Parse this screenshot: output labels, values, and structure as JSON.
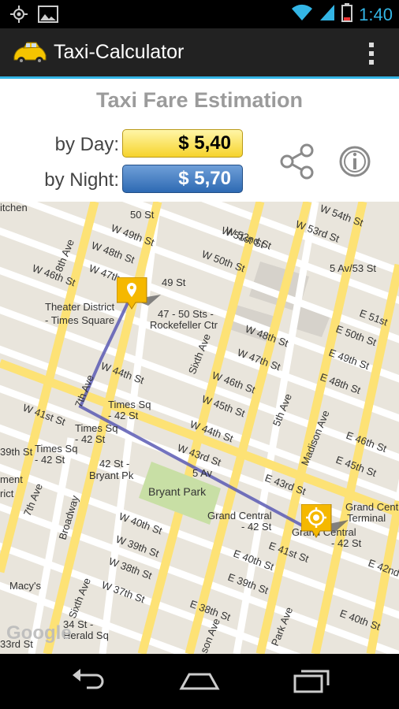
{
  "status": {
    "time": "1:40"
  },
  "app": {
    "title": "Taxi-Calculator"
  },
  "fare": {
    "heading": "Taxi Fare Estimation",
    "day_label": "by Day:",
    "day_value": "$ 5,40",
    "night_label": "by Night:",
    "night_value": "$ 5,70"
  },
  "map": {
    "labels": {
      "kitchen": "itchen",
      "w52": "W 52nd St",
      "w54": "W 54th St",
      "st50": "50 St",
      "w49": "W 49th St",
      "w51": "W 51st St",
      "w53": "W 53rd St",
      "ave8": "8th Ave",
      "w48a": "W 48th St",
      "w50": "W 50th St",
      "av5_53": "5 Av/53 St",
      "w46": "W 46th St",
      "w47a": "W 47th St",
      "st49": "49 St",
      "theater1": "Theater District",
      "theater2": "- Times Square",
      "rock1": "47 - 50 Sts -",
      "rock2": "Rockefeller Ctr",
      "e51": "E 51st",
      "w48b": "W 48th St",
      "e50": "E 50th St",
      "sixth_ave_n": "Sixth Ave",
      "w47b": "W 47th St",
      "e49": "E 49th St",
      "w44a": "W 44th St",
      "w46b": "W 46th St",
      "e48": "E 48th St",
      "ave7": "7th Ave",
      "w45": "W 45th St",
      "fifth_ave": "5th Ave",
      "ts1": "Times Sq",
      "ts2": "- 42 St",
      "w41": "W 41st St",
      "ts3": "Times Sq",
      "ts4": "- 42 St",
      "w44b": "W 44th St",
      "madison": "Madison Ave",
      "e46": "E 46th St",
      "w43": "W 43rd St",
      "ts5": "Times Sq",
      "ts6": "- 42 St",
      "e45": "E 45th St",
      "w39": "39th St",
      "bp1": "42 St -",
      "bp2": "Bryant Pk",
      "av5": "5 Av",
      "e43": "E 43rd St",
      "ment": "ment",
      "rict": "rict",
      "ave7b": "7th Ave",
      "broadway": "Broadway",
      "bryant": "Bryant Park",
      "gc1": "Grand Central",
      "gc2": "- 42 St",
      "gct1": "Grand Centr",
      "gct2": "Terminal",
      "gc3": "Grand Central",
      "gc4": "- 42 St",
      "w40": "W 40th St",
      "e41": "E 41st St",
      "w39b": "W 39th St",
      "e40a": "E 40th St",
      "e42": "E 42nd",
      "w38": "W 38th St",
      "macys": "Macy's",
      "sixth_ave_s": "Sixth Ave",
      "w37": "W 37th St",
      "e39": "E 39th St",
      "e38": "E 38th St",
      "park_ave": "Park Ave",
      "e40b": "E 40th St",
      "hs1": "34 St -",
      "hs2": "Herald Sq",
      "st33": "33rd St",
      "son_ave": "son Ave",
      "google": "Google"
    }
  },
  "icons": {
    "location": "gps-icon",
    "gallery": "image-icon",
    "wifi": "wifi-icon",
    "signal": "signal-icon",
    "battery": "battery-icon",
    "share": "share-icon",
    "info": "info-icon",
    "start": "start-marker-icon",
    "destination": "destination-marker-icon"
  },
  "colors": {
    "accent": "#33b5e5",
    "day": "#f6d32c",
    "night": "#2e6ab3",
    "route": "#5a5ab4",
    "marker": "#f5b800"
  }
}
